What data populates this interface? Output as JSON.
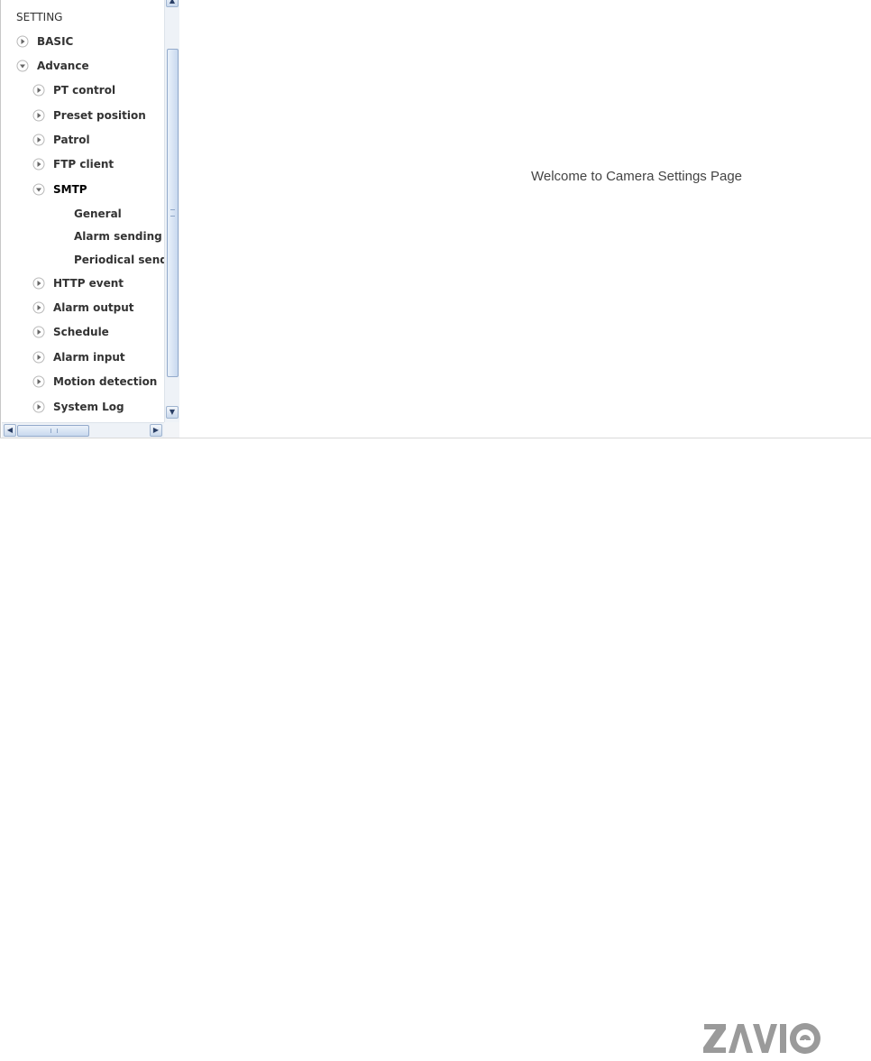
{
  "tree": {
    "header": "SETTING",
    "items": [
      {
        "label": "BASIC",
        "state": "collapsed"
      },
      {
        "label": "Advance",
        "state": "expanded"
      },
      {
        "label": "PT control",
        "state": "collapsed"
      },
      {
        "label": "Preset position",
        "state": "collapsed"
      },
      {
        "label": "Patrol",
        "state": "collapsed"
      },
      {
        "label": "FTP client",
        "state": "collapsed"
      },
      {
        "label": "SMTP",
        "state": "expanded"
      },
      {
        "label": "General",
        "state": "leaf"
      },
      {
        "label": "Alarm sending",
        "state": "leaf"
      },
      {
        "label": "Periodical sending",
        "state": "leaf"
      },
      {
        "label": "HTTP event",
        "state": "collapsed"
      },
      {
        "label": "Alarm output",
        "state": "collapsed"
      },
      {
        "label": "Schedule",
        "state": "collapsed"
      },
      {
        "label": "Alarm input",
        "state": "collapsed"
      },
      {
        "label": "Motion detection",
        "state": "collapsed"
      },
      {
        "label": "System Log",
        "state": "collapsed"
      }
    ]
  },
  "main": {
    "welcome_text": "Welcome to Camera Settings Page"
  },
  "logo": {
    "text": "ZAVIO"
  },
  "icons": {
    "collapsed": "tree-collapsed-arrow-icon",
    "expanded": "tree-expanded-arrow-icon",
    "scroll_up": "scroll-up-arrow-icon",
    "scroll_down": "scroll-down-arrow-icon",
    "scroll_left": "scroll-left-arrow-icon",
    "scroll_right": "scroll-right-arrow-icon"
  },
  "colors": {
    "scrollbar_track": "#eef2f7",
    "scrollbar_thumb": "#c8d9ef",
    "logo_gray": "#9a9a9a"
  }
}
